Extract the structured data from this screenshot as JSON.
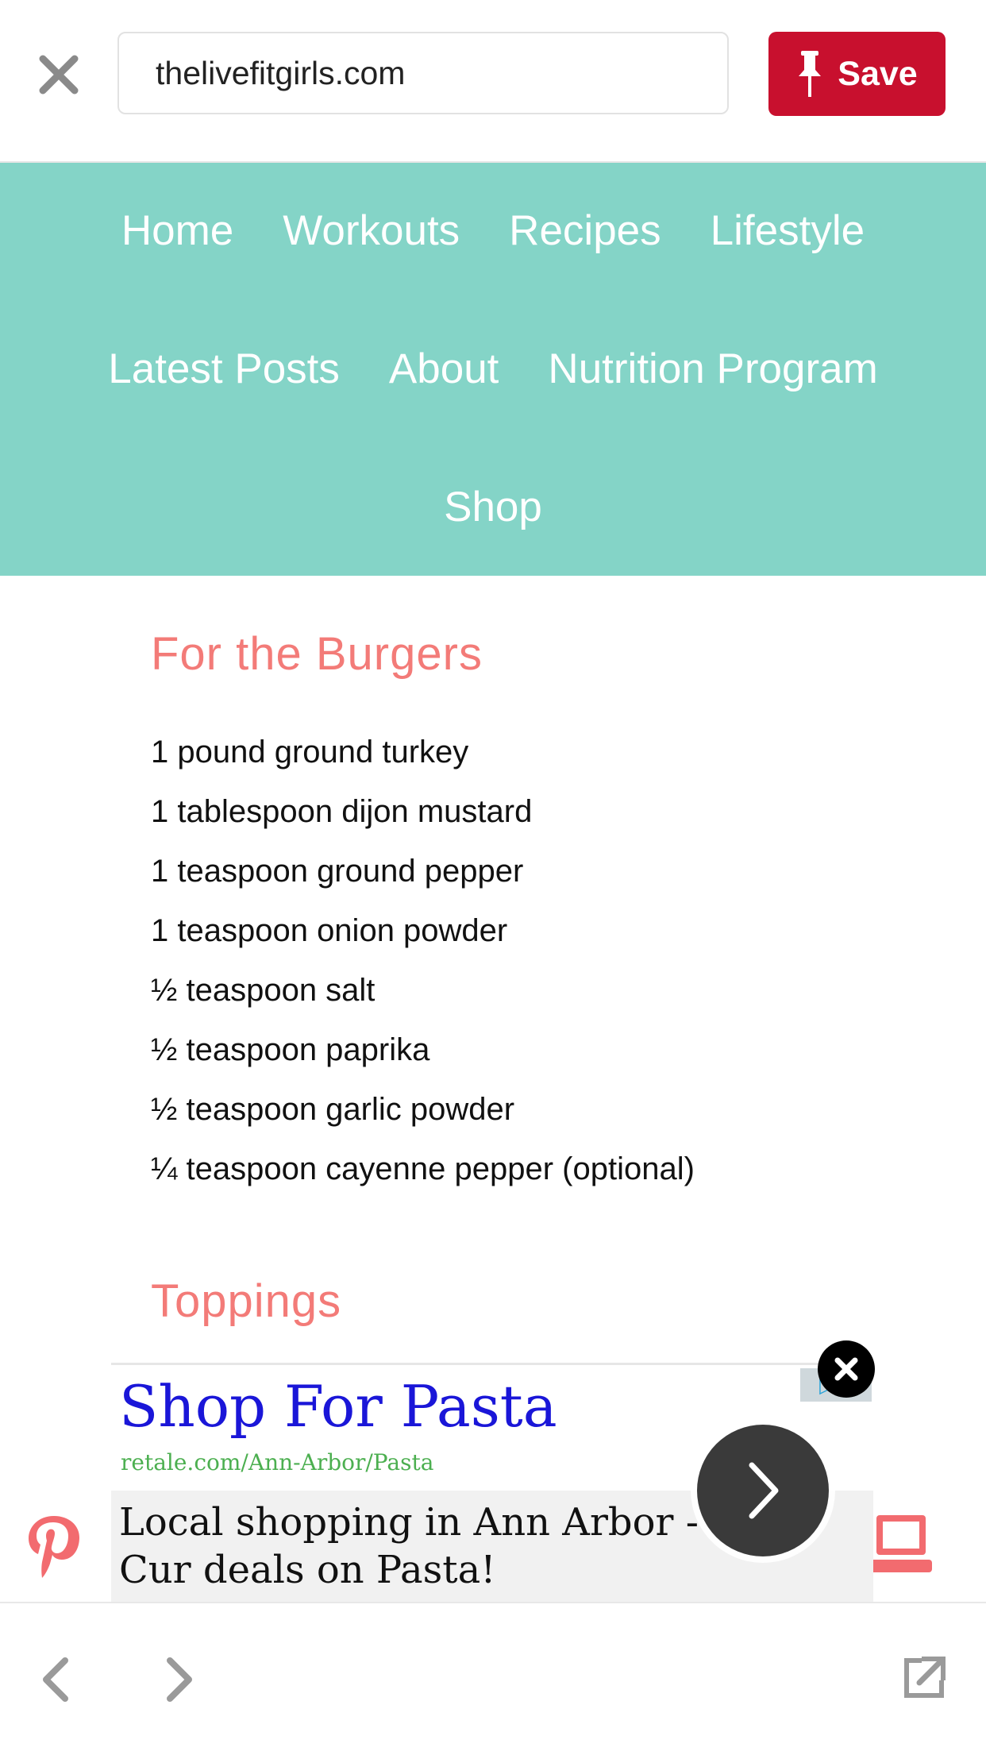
{
  "topbar": {
    "url": "thelivefitgirls.com",
    "save_label": "Save"
  },
  "nav": {
    "row1": [
      "Home",
      "Workouts",
      "Recipes",
      "Lifestyle"
    ],
    "row2": [
      "Latest Posts",
      "About",
      "Nutrition Program"
    ],
    "row3": [
      "Shop"
    ]
  },
  "recipe": {
    "burgers_heading": "For the Burgers",
    "ingredients": [
      "1 pound ground turkey",
      "1 tablespoon dijon mustard",
      "1 teaspoon ground pepper",
      "1 teaspoon onion powder",
      "½ teaspoon salt",
      "½ teaspoon paprika",
      "½ teaspoon garlic powder",
      "¼ teaspoon cayenne pepper (optional)"
    ],
    "toppings_heading": "Toppings"
  },
  "ad": {
    "title": "Shop For Pasta",
    "url": "retale.com/Ann-Arbor/Pasta",
    "text": "Local shopping in Ann Arbor - Cur deals on Pasta!"
  },
  "icons": {
    "close": "close-icon",
    "pin": "pin-icon",
    "pinterest": "pinterest-icon",
    "laptop": "laptop-icon",
    "back": "chevron-left-icon",
    "forward": "chevron-right-icon",
    "external": "external-link-icon",
    "next": "chevron-right-icon",
    "ad_close": "close-icon"
  },
  "colors": {
    "save_red": "#c8102e",
    "nav_teal": "#84d4c7",
    "heading_coral": "#f37b78",
    "ad_blue": "#1a16d8",
    "ad_green": "#4caf50"
  }
}
